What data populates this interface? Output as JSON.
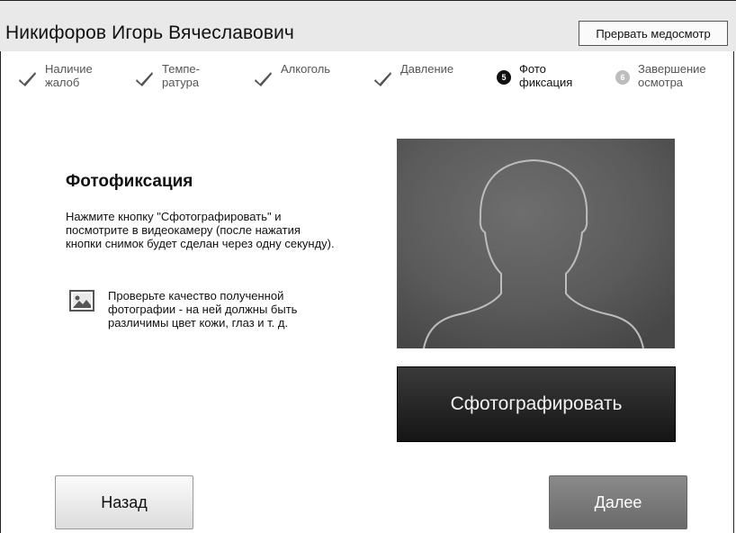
{
  "header": {
    "patient_name": "Никифоров Игорь Вячеславович",
    "abort_button": "Прервать медосмотр"
  },
  "steps": [
    {
      "label": "Наличие\nжалоб",
      "state": "done",
      "icon": "check-icon"
    },
    {
      "label": "Темпе-\nратура",
      "state": "done",
      "icon": "check-icon"
    },
    {
      "label": "Алкоголь",
      "state": "done",
      "icon": "check-icon"
    },
    {
      "label": "Давление",
      "state": "done",
      "icon": "check-icon"
    },
    {
      "label": "Фото\nфиксация",
      "state": "active",
      "number": "5"
    },
    {
      "label": "Завершение\nосмотра",
      "state": "pending",
      "number": "6"
    }
  ],
  "main": {
    "title": "Фотофиксация",
    "instruction": "Нажмите кнопку \"Сфотографировать\" и посмотрите в видеокамеру (после нажатия кнопки снимок будет сделан через одну секунду).",
    "hint": "Проверьте качество полученной фотографии - на ней должны быть различимы цвет кожи, глаз и т. д.",
    "hint_icon": "image-icon",
    "shoot_button": "Сфотографировать"
  },
  "footer": {
    "back_button": "Назад",
    "next_button": "Далее"
  },
  "colors": {
    "header_bg": "#e9e9e9",
    "shoot_button_bg": "#1e1e1e",
    "next_button_bg": "#7a7a7a",
    "active_step": "#111111",
    "pending_step": "#bdbdbd"
  }
}
